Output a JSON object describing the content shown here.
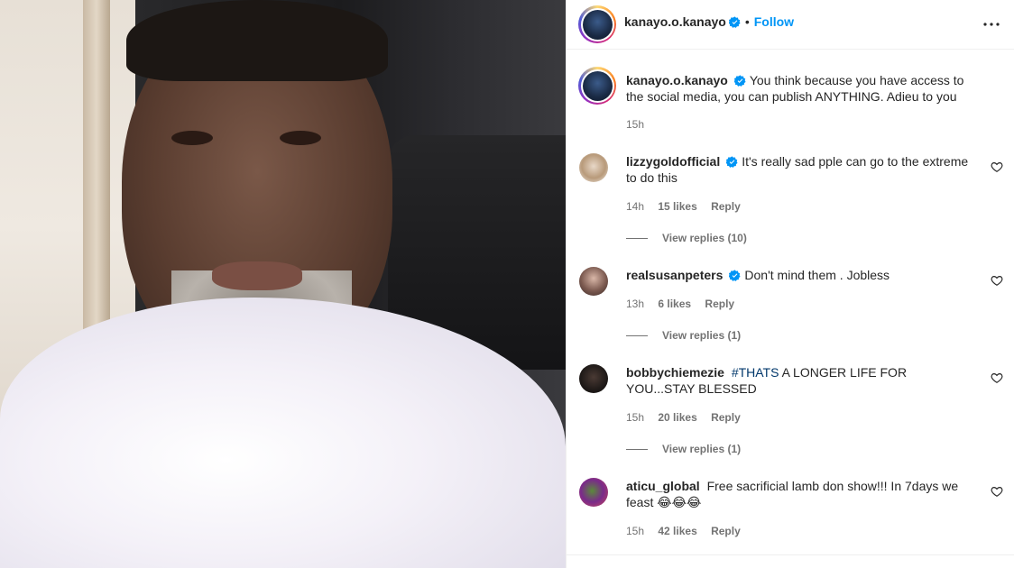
{
  "post": {
    "author": "kanayo.o.kanayo",
    "follow_label": "Follow",
    "separator": "•",
    "caption": "You think because you have access to the social media, you can publish ANYTHING. Adieu to you",
    "caption_time": "15h"
  },
  "comments": [
    {
      "username": "lizzygoldofficial",
      "verified": true,
      "text": "It's really sad pple can go to the extreme to do this",
      "time": "14h",
      "likes": "15 likes",
      "reply_label": "Reply",
      "view_replies": "View replies (10)"
    },
    {
      "username": "realsusanpeters",
      "verified": true,
      "text": "Don't mind them . Jobless",
      "time": "13h",
      "likes": "6 likes",
      "reply_label": "Reply",
      "view_replies": "View replies (1)"
    },
    {
      "username": "bobbychiemezie",
      "verified": false,
      "hashtag": "#THATS",
      "text": "A LONGER LIFE FOR YOU...STAY BLESSED",
      "time": "15h",
      "likes": "20 likes",
      "reply_label": "Reply",
      "view_replies": "View replies (1)"
    },
    {
      "username": "aticu_global",
      "verified": false,
      "text": "Free sacrificial lamb don show!!! In 7days we feast",
      "emoji": "😂😂😂",
      "time": "15h",
      "likes": "42 likes",
      "reply_label": "Reply"
    }
  ],
  "colors": {
    "accent": "#0095f6",
    "verified": "#0095f6",
    "muted": "#737373",
    "hashtag": "#00376b"
  }
}
